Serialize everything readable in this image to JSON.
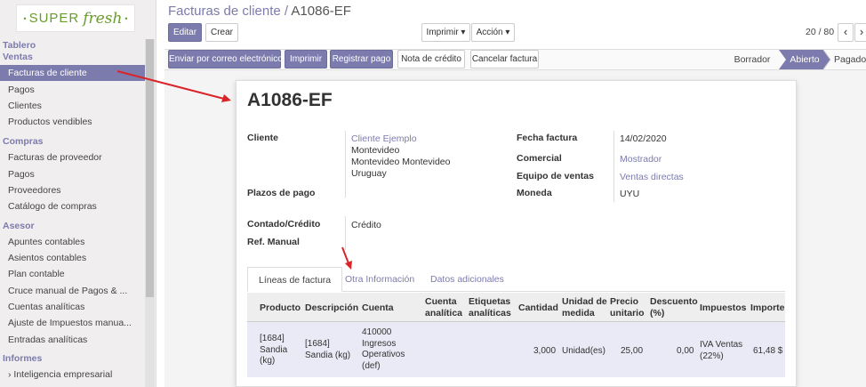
{
  "logo": {
    "super": "SUPER",
    "fresh": "fresh",
    "dot": "•"
  },
  "sidebar": {
    "tablero": "Tablero",
    "ventas": "Ventas",
    "ventas_items": [
      "Facturas de cliente",
      "Pagos",
      "Clientes",
      "Productos vendibles"
    ],
    "compras": "Compras",
    "compras_items": [
      "Facturas de proveedor",
      "Pagos",
      "Proveedores",
      "Catálogo de compras"
    ],
    "asesor": "Asesor",
    "asesor_items": [
      "Apuntes contables",
      "Asientos contables",
      "Plan contable",
      "Cruce manual de Pagos & ...",
      "Cuentas analíticas",
      "Ajuste de Impuestos manua...",
      "Entradas analíticas"
    ],
    "informes": "Informes",
    "informes_items": [
      "› Inteligencia empresarial"
    ]
  },
  "breadcrumb": {
    "parent": "Facturas de cliente",
    "sep": " / ",
    "current": "A1086-EF"
  },
  "toolbar": {
    "edit": "Editar",
    "create": "Crear",
    "print": "Imprimir ▾",
    "action": "Acción ▾",
    "pager": "20 / 80",
    "prev": "‹",
    "next": "›"
  },
  "actions": {
    "email": "Enviar por correo electrónico",
    "print": "Imprimir",
    "register_payment": "Registrar pago",
    "credit_note": "Nota de crédito",
    "cancel": "Cancelar factura"
  },
  "stages": {
    "draft": "Borrador",
    "open": "Abierto",
    "paid": "Pagado"
  },
  "invoice": {
    "number": "A1086-EF",
    "cliente_label": "Cliente",
    "cliente_name": "Cliente Ejemplo",
    "cliente_addr1": "Montevideo",
    "cliente_addr2": "Montevideo Montevideo",
    "cliente_addr3": "Uruguay",
    "plazos_label": "Plazos de pago",
    "contado_label": "Contado/Crédito",
    "contado_value": "Crédito",
    "ref_label": "Ref. Manual",
    "fecha_label": "Fecha factura",
    "fecha_value": "14/02/2020",
    "comercial_label": "Comercial",
    "comercial_value": "Mostrador",
    "equipo_label": "Equipo de ventas",
    "equipo_value": "Ventas directas",
    "moneda_label": "Moneda",
    "moneda_value": "UYU"
  },
  "tabs": [
    "Líneas de factura",
    "Otra Información",
    "Datos adicionales"
  ],
  "table": {
    "headers": {
      "producto": "Producto",
      "descripcion": "Descripción",
      "cuenta": "Cuenta",
      "cuenta_analitica_1": "Cuenta",
      "cuenta_analitica_2": "analítica",
      "etiquetas_1": "Etiquetas",
      "etiquetas_2": "analíticas",
      "cantidad": "Cantidad",
      "unidad_1": "Unidad de",
      "unidad_2": "medida",
      "precio_1": "Precio",
      "precio_2": "unitario",
      "descuento_1": "Descuento",
      "descuento_2": "(%)",
      "impuestos": "Impuestos",
      "importe": "Importe"
    },
    "row": {
      "producto_1": "[1684]",
      "producto_2": "Sandia",
      "producto_3": "(kg)",
      "descripcion_1": "[1684]",
      "descripcion_2": "Sandia (kg)",
      "cuenta_1": "410000",
      "cuenta_2": "Ingresos",
      "cuenta_3": "Operativos",
      "cuenta_4": "(def)",
      "cantidad": "3,000",
      "unidad": "Unidad(es)",
      "precio": "25,00",
      "descuento": "0,00",
      "impuestos_1": "IVA Ventas",
      "impuestos_2": "(22%)",
      "importe": "61,48 $"
    }
  },
  "colors": {
    "brand": "#7c7bad",
    "logo_green": "#6a9c2c",
    "annotation_red": "#d9252a"
  }
}
